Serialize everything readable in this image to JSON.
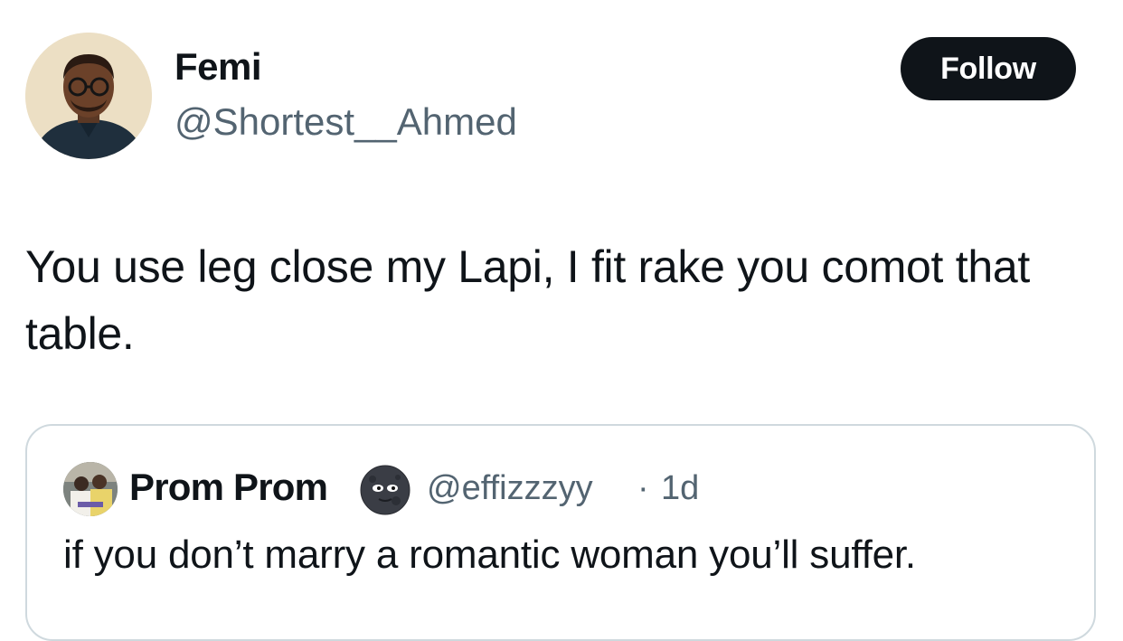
{
  "tweet": {
    "author": {
      "name": "Femi",
      "handle": "@Shortest__Ahmed",
      "avatar": "profile-photo-man-glasses"
    },
    "follow_label": "Follow",
    "text": "You use leg close my Lapi, I fit rake you comot that table."
  },
  "quote": {
    "author": {
      "name": "Prom Prom",
      "emoji": "new-moon-face-icon",
      "handle": "@effizzzyy",
      "separator": "·",
      "time": "1d",
      "avatar": "profile-photo-group"
    },
    "text": "if you don’t marry a romantic woman you’ll suffer."
  },
  "colors": {
    "text": "#0f1419",
    "secondary": "#536471",
    "button_bg": "#0f1419",
    "button_text": "#ffffff",
    "border": "#cfd9de"
  }
}
